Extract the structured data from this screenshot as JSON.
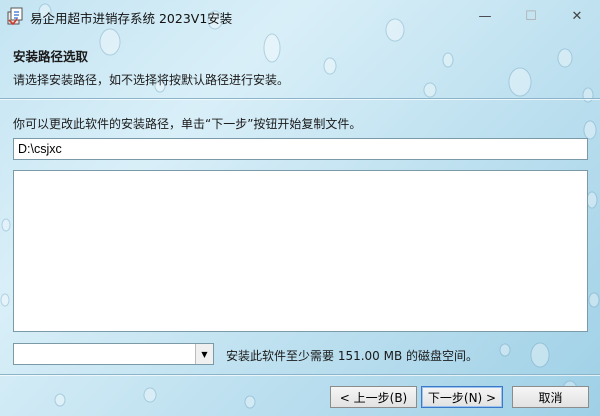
{
  "window": {
    "title": "易企用超市进销存系统 2023V1安装",
    "min_glyph": "—",
    "max_glyph": "☐",
    "close_glyph": "✕"
  },
  "header": {
    "title": "安装路径选取",
    "subtitle": "请选择安装路径，如不选择将按默认路径进行安装。"
  },
  "main": {
    "description": "你可以更改此软件的安装路径，单击“下一步”按钮开始复制文件。",
    "install_path": "D:\\csjxc",
    "drive_select_value": "",
    "drive_arrow": "▼",
    "space_note": "安装此软件至少需要 151.00 MB 的磁盘空间。"
  },
  "footer": {
    "back_label": "< 上一步(B)",
    "next_label": "下一步(N) >",
    "cancel_label": "取消"
  },
  "icons": {
    "app": "installer-icon",
    "minimize": "minimize-icon",
    "maximize": "maximize-icon",
    "close": "close-icon"
  },
  "colors": {
    "background": "#c4e4f2",
    "accent": "#3c78c8"
  }
}
